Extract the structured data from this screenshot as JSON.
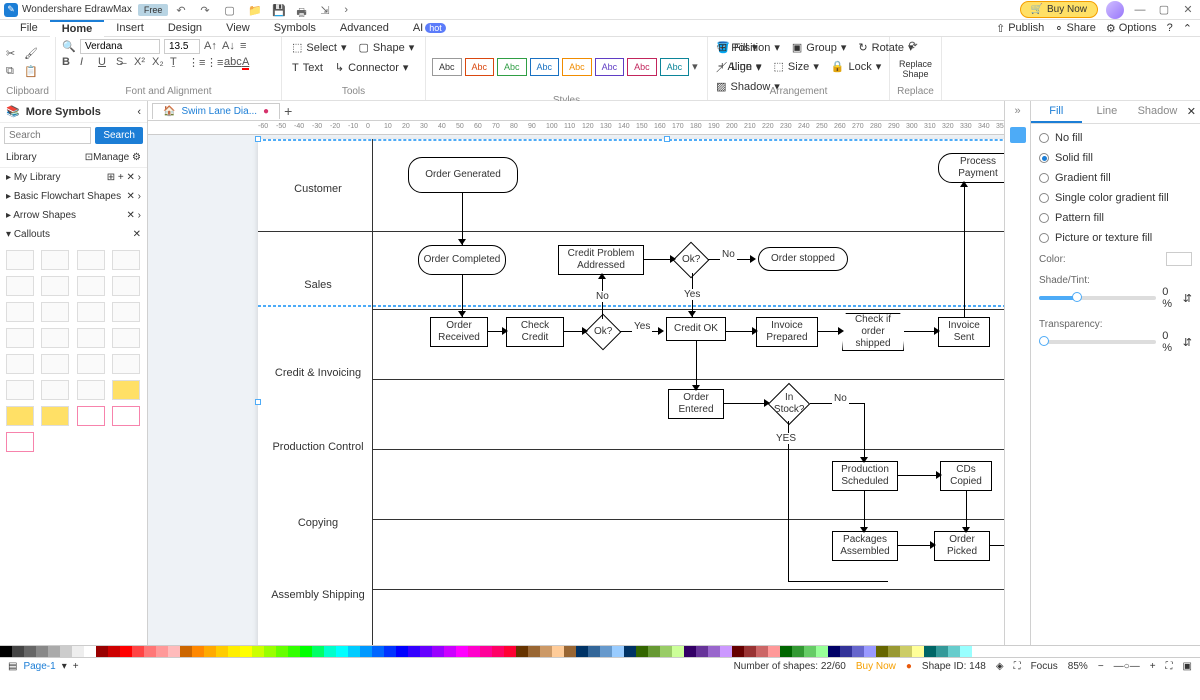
{
  "titlebar": {
    "app_name": "Wondershare EdrawMax",
    "free_badge": "Free",
    "buy_now": "Buy Now"
  },
  "menubar": {
    "items": [
      "File",
      "Home",
      "Insert",
      "Design",
      "View",
      "Symbols",
      "Advanced",
      "AI"
    ],
    "right": {
      "publish": "Publish",
      "share": "Share",
      "options": "Options"
    }
  },
  "ribbon": {
    "clipboard": {
      "label": "Clipboard"
    },
    "font": {
      "label": "Font and Alignment",
      "font": "Verdana",
      "size": "13.5"
    },
    "tools": {
      "label": "Tools",
      "select": "Select",
      "shape": "Shape",
      "text": "Text",
      "connector": "Connector"
    },
    "styles": {
      "label": "Styles",
      "abc": "Abc",
      "fill": "Fill",
      "line": "Line",
      "shadow": "Shadow"
    },
    "arrange": {
      "label": "Arrangement",
      "position": "Position",
      "group": "Group",
      "rotate": "Rotate",
      "align": "Align",
      "size": "Size",
      "lock": "Lock"
    },
    "replace": {
      "label": "Replace",
      "replace_shape": "Replace Shape"
    }
  },
  "left_panel": {
    "more_symbols": "More Symbols",
    "search_ph": "Search",
    "search_btn": "Search",
    "library": "Library",
    "manage": "Manage",
    "my_library": "My Library",
    "sections": [
      "Basic Flowchart Shapes",
      "Arrow Shapes",
      "Callouts"
    ]
  },
  "doc_tab": {
    "name": "Swim Lane Dia..."
  },
  "lanes": [
    "Customer",
    "Sales",
    "Credit & Invoicing",
    "Production Control",
    "Copying",
    "Assembly Shipping"
  ],
  "nodes": {
    "order_generated": "Order Generated",
    "order_completed": "Order Completed",
    "credit_problem": "Credit Problem Addressed",
    "ok1": "Ok?",
    "order_stopped": "Order stopped",
    "order_received": "Order Received",
    "check_credit": "Check Credit",
    "ok2": "Ok?",
    "credit_ok": "Credit OK",
    "invoice_prepared": "Invoice Prepared",
    "check_shipped": "Check if order shipped",
    "invoice_sent": "Invoice Sent",
    "process_payment": "Process Payment",
    "order_entered": "Order Entered",
    "in_stock": "In Stock?",
    "production_scheduled": "Production Scheduled",
    "cds_copied": "CDs Copied",
    "packages_assembled": "Packages Assembled",
    "order_picked": "Order Picked"
  },
  "edge_labels": {
    "yes": "Yes",
    "no": "No",
    "yes2": "YES",
    "no2": "No"
  },
  "right_panel": {
    "tabs": [
      "Fill",
      "Line",
      "Shadow"
    ],
    "options": [
      "No fill",
      "Solid fill",
      "Gradient fill",
      "Single color gradient fill",
      "Pattern fill",
      "Picture or texture fill"
    ],
    "color": "Color:",
    "shade": "Shade/Tint:",
    "shade_val": "0 %",
    "transparency": "Transparency:",
    "trans_val": "0 %"
  },
  "status": {
    "page": "Page-1",
    "shapes": "Number of shapes: 22/60",
    "buy": "Buy Now",
    "shape_id": "Shape ID: 148",
    "focus": "Focus",
    "zoom": "85%"
  }
}
